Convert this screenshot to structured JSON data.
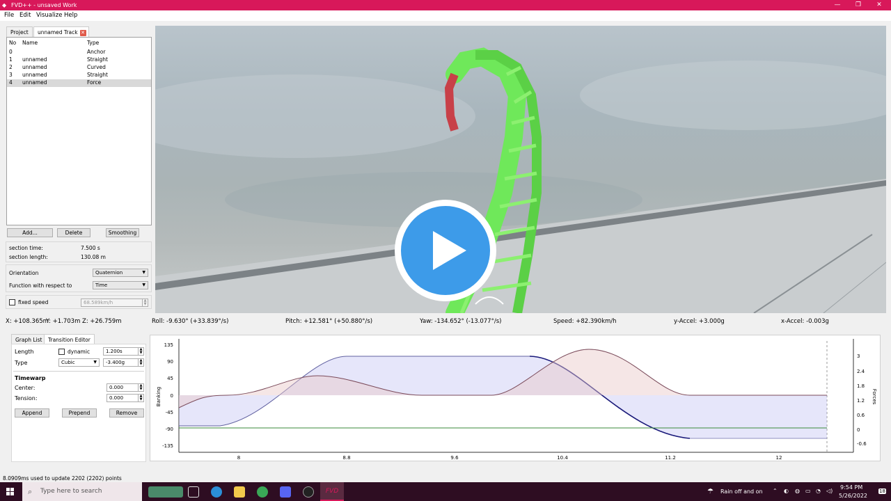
{
  "window": {
    "title": "FVD++ - unsaved Work",
    "min": "—",
    "max": "❐",
    "close": "✕"
  },
  "menu": [
    "File",
    "Edit",
    "Visualize",
    "Help"
  ],
  "tabs": {
    "project": "Project",
    "track": "unnamed Track"
  },
  "section_list": {
    "headers": [
      "No",
      "Name",
      "Type"
    ],
    "rows": [
      {
        "no": "0",
        "name": "",
        "type": "Anchor"
      },
      {
        "no": "1",
        "name": "unnamed",
        "type": "Straight"
      },
      {
        "no": "2",
        "name": "unnamed",
        "type": "Curved"
      },
      {
        "no": "3",
        "name": "unnamed",
        "type": "Straight"
      },
      {
        "no": "4",
        "name": "unnamed",
        "type": "Force"
      }
    ]
  },
  "buttons": {
    "add": "Add...",
    "delete": "Delete",
    "smoothing": "Smoothing"
  },
  "section_info": {
    "time_label": "section time:",
    "time_value": "7.500 s",
    "length_label": "section length:",
    "length_value": "130.08 m"
  },
  "orientation": {
    "label": "Orientation",
    "value": "Quaternion"
  },
  "function_respect": {
    "label": "Function with respect to",
    "value": "Time"
  },
  "fixed_speed": {
    "label": "fixed speed",
    "value": "68.589km/h"
  },
  "status": {
    "x": "X: +108.365m",
    "y": "Y: +1.703m",
    "z": "Z: +26.759m",
    "roll": "Roll: -9.630° (+33.839°/s)",
    "pitch": "Pitch: +12.581° (+50.880°/s)",
    "yaw": "Yaw: -134.652° (-13.077°/s)",
    "speed": "Speed: +82.390km/h",
    "yaccel": "y-Accel: +3.000g",
    "xaccel": "x-Accel: -0.003g"
  },
  "editor_tabs": {
    "graph_list": "Graph List",
    "transition": "Transition Editor"
  },
  "transition": {
    "length_label": "Length",
    "dynamic_label": "dynamic",
    "length_value": "1.200s",
    "type_label": "Type",
    "type_value": "Cubic",
    "type_amount": "-3.400g",
    "timewarp_label": "Timewarp",
    "center_label": "Center:",
    "center_value": "0.000",
    "tension_label": "Tension:",
    "tension_value": "0.000"
  },
  "edit_buttons": {
    "append": "Append",
    "prepend": "Prepend",
    "remove": "Remove"
  },
  "graph": {
    "left_axis_label": "Banking",
    "right_axis_label": "Forces",
    "left_ticks": [
      "135",
      "90",
      "45",
      "0",
      "-45",
      "-90",
      "-135"
    ],
    "right_ticks": [
      "3",
      "2.4",
      "1.8",
      "1.2",
      "0.6",
      "0",
      "-0.6"
    ],
    "x_ticks": [
      "8",
      "8.8",
      "9.6",
      "10.4",
      "11.2",
      "12"
    ],
    "colors": {
      "banking": "#1a1a7a",
      "force": "#7a4a5a",
      "lateral": "#3a8a3a"
    }
  },
  "statusbar": "8.0909ms used to update 2202 (2202) points",
  "taskbar": {
    "search_placeholder": "Type here to search",
    "app_label": "FVD",
    "weather": "Rain off and on",
    "time": "9:54 PM",
    "date": "5/26/2022",
    "notif": "18"
  },
  "viewport": {
    "track_color": "#6fe85a",
    "highlight_color": "#c84048",
    "play_color": "#3d9be9"
  }
}
